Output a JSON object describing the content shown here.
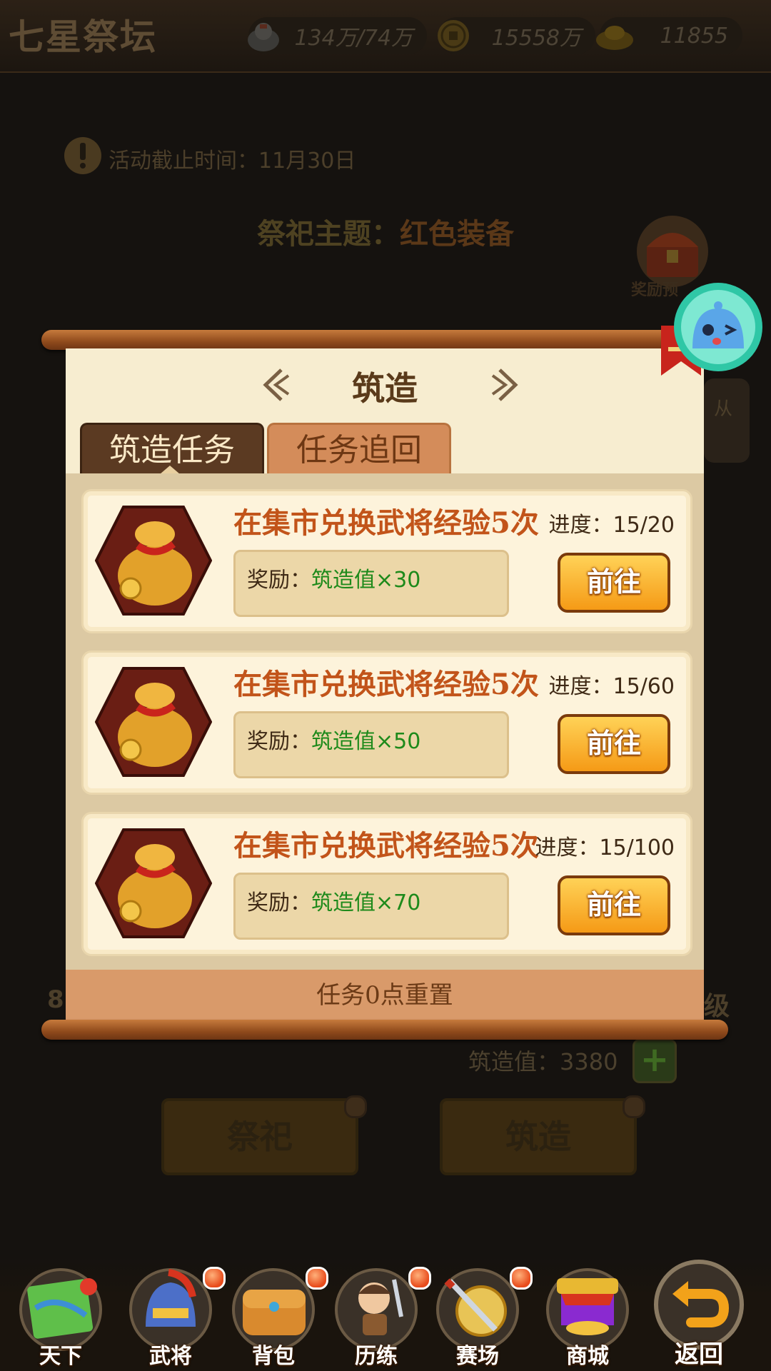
{
  "header": {
    "title": "七星祭坛",
    "resources": [
      {
        "icon": "silver-ingot-icon",
        "value": "134万/74万"
      },
      {
        "icon": "copper-coin-icon",
        "value": "15558万"
      },
      {
        "icon": "gold-ingot-icon",
        "value": "11855"
      }
    ]
  },
  "background": {
    "deadline": "活动截止时间：11月30日",
    "theme_label": "祭祀主题：",
    "theme_value": "红色装备",
    "reward_chest_label": "奖励预",
    "side_card_text": "从",
    "left_partial": "8",
    "right_partial": "级",
    "forge_value": "筑造值：3380",
    "plus_label": "+",
    "buttons": [
      "祭祀",
      "筑造"
    ]
  },
  "panel": {
    "title": "筑造",
    "tabs": [
      "筑造任务",
      "任务追回"
    ],
    "active_tab": 0,
    "tasks": [
      {
        "title": "在集市兑换武将经验5次",
        "progress": "进度：15/20",
        "reward_label": "奖励：",
        "reward_value": "筑造值×30",
        "button": "前往"
      },
      {
        "title": "在集市兑换武将经验5次",
        "progress": "进度：15/60",
        "reward_label": "奖励：",
        "reward_value": "筑造值×50",
        "button": "前往"
      },
      {
        "title": "在集市兑换武将经验5次",
        "progress": "进度：15/100",
        "reward_label": "奖励：",
        "reward_value": "筑造值×70",
        "button": "前往"
      }
    ],
    "footer": "任务0点重置"
  },
  "nav": [
    {
      "label": "天下",
      "icon": "map-icon",
      "dot": false
    },
    {
      "label": "武将",
      "icon": "helmet-icon",
      "dot": true
    },
    {
      "label": "背包",
      "icon": "bag-icon",
      "dot": true
    },
    {
      "label": "历练",
      "icon": "warrior-icon",
      "dot": true
    },
    {
      "label": "赛场",
      "icon": "arena-icon",
      "dot": true
    },
    {
      "label": "商城",
      "icon": "shop-icon",
      "dot": false
    },
    {
      "label": "返回",
      "icon": "back-arrow-icon",
      "dot": false
    }
  ],
  "colors": {
    "task_title": "#c2541a",
    "reward_value": "#1e8a1b",
    "go_button": "#f59a16",
    "paper": "#f6ebcb"
  }
}
